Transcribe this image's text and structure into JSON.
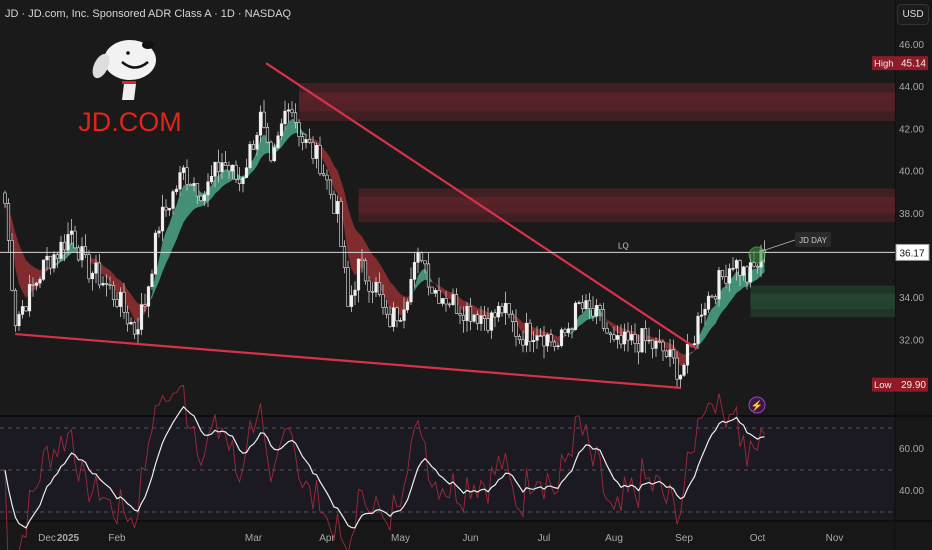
{
  "header": {
    "title": "JD · JD.com, Inc. Sponsored ADR Class A · 1D · NASDAQ",
    "currency": "USD"
  },
  "logo": {
    "text": "JD.COM"
  },
  "chart_data": {
    "type": "candlestick",
    "x_unit": "trading day index",
    "price_axis": {
      "ticks": [
        46,
        44,
        42,
        40,
        38,
        36,
        34,
        32
      ],
      "labels": [
        "46.00",
        "44.00",
        "42.00",
        "40.00",
        "38.00",
        "",
        "34.00",
        "32.00"
      ],
      "range": [
        29.2,
        46.4
      ]
    },
    "time_axis": {
      "labels": [
        {
          "text": "Dec",
          "day": 12
        },
        {
          "text": "2025",
          "day": 18,
          "bold": true
        },
        {
          "text": "Feb",
          "day": 32
        },
        {
          "text": "Mar",
          "day": 71
        },
        {
          "text": "Apr",
          "day": 92
        },
        {
          "text": "May",
          "day": 113
        },
        {
          "text": "Jun",
          "day": 133
        },
        {
          "text": "Jul",
          "day": 154
        },
        {
          "text": "Aug",
          "day": 174
        },
        {
          "text": "Sep",
          "day": 194
        },
        {
          "text": "Oct",
          "day": 215
        },
        {
          "text": "Nov",
          "day": 237
        }
      ]
    },
    "close_keypoints": [
      [
        0,
        38.5
      ],
      [
        3,
        33.0
      ],
      [
        8,
        34.5
      ],
      [
        12,
        35.8
      ],
      [
        15,
        36.2
      ],
      [
        19,
        37.2
      ],
      [
        23,
        35.5
      ],
      [
        27,
        35.0
      ],
      [
        32,
        34.0
      ],
      [
        37,
        32.5
      ],
      [
        40,
        33.8
      ],
      [
        44,
        37.5
      ],
      [
        51,
        40.0
      ],
      [
        57,
        39.0
      ],
      [
        62,
        40.5
      ],
      [
        67,
        39.5
      ],
      [
        73,
        42.5
      ],
      [
        76,
        40.0
      ],
      [
        81,
        43.5
      ],
      [
        85,
        41.5
      ],
      [
        90,
        40.5
      ],
      [
        95,
        38.0
      ],
      [
        98,
        33.5
      ],
      [
        101,
        35.5
      ],
      [
        106,
        34.5
      ],
      [
        109,
        32.8
      ],
      [
        113,
        33.5
      ],
      [
        119,
        36.2
      ],
      [
        122,
        34.5
      ],
      [
        130,
        33.6
      ],
      [
        139,
        33.0
      ],
      [
        142,
        33.5
      ],
      [
        147,
        32.2
      ],
      [
        152,
        32.6
      ],
      [
        158,
        31.7
      ],
      [
        164,
        33.6
      ],
      [
        170,
        33.0
      ],
      [
        174,
        31.7
      ],
      [
        182,
        32.0
      ],
      [
        188,
        31.5
      ],
      [
        193,
        30.5
      ],
      [
        196,
        31.6
      ],
      [
        199,
        33.6
      ],
      [
        205,
        35.0
      ],
      [
        208,
        35.8
      ],
      [
        212,
        35.0
      ],
      [
        215,
        35.6
      ],
      [
        217,
        36.17
      ]
    ],
    "high": {
      "label": "High",
      "value": "45.14"
    },
    "low": {
      "label": "Low",
      "value": "29.90"
    },
    "last_price": "36.17",
    "lq_line": {
      "label": "LQ",
      "price": 36.17
    },
    "callout": {
      "label": "JD DAY"
    },
    "upper_trendline": [
      [
        74.6,
        45.14
      ],
      [
        197.7,
        31.6
      ]
    ],
    "lower_trendline": [
      [
        2.9,
        32.3
      ],
      [
        193,
        29.75
      ]
    ],
    "zones": [
      {
        "from_day": 84,
        "top": 44.2,
        "bottom": 42.4,
        "color": "#8a2a35"
      },
      {
        "from_day": 101,
        "top": 39.2,
        "bottom": 37.6,
        "color": "#8a2a35"
      },
      {
        "from_day": 213,
        "top": 34.6,
        "bottom": 33.1,
        "color": "#2f6a45"
      }
    ],
    "rsi": {
      "ticks": [
        60,
        40
      ],
      "labels": [
        "60.00",
        "40.00"
      ],
      "levels": [
        70,
        50,
        30
      ]
    },
    "colors": {
      "up": "#f0f0f0",
      "ribbon_up": "#4fae8e",
      "ribbon_down": "#9a2f33",
      "trend": "#d8324a",
      "label_red": "#8e1b26"
    }
  }
}
